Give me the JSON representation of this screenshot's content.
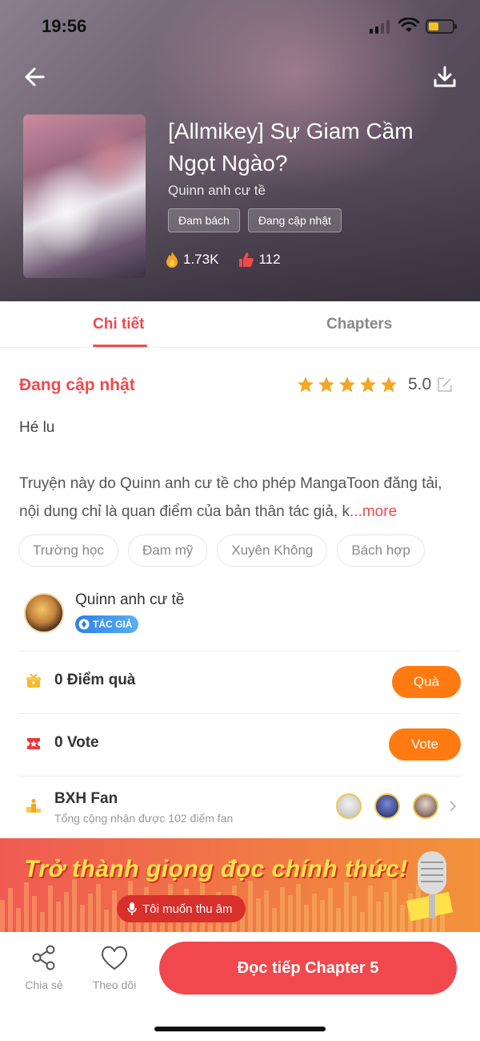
{
  "status_bar": {
    "time": "19:56"
  },
  "header": {
    "title": "[Allmikey] Sự Giam Cầm Ngọt Ngào?",
    "author": "Quinn anh cư tề",
    "genre_tags": [
      "Đam bách",
      "Đang cập nhật"
    ],
    "stats": {
      "views": "1.73K",
      "likes": "112"
    },
    "icons": {
      "back": "back-arrow-icon",
      "download": "download-icon",
      "views": "fire-icon",
      "likes": "thumb-up-icon"
    }
  },
  "tabs": [
    {
      "label": "Chi tiết",
      "active": true
    },
    {
      "label": "Chapters",
      "active": false
    }
  ],
  "details": {
    "status": "Đang cập nhật",
    "rating": {
      "stars": 5,
      "value": "5.0"
    },
    "subtitle": "Hé lu",
    "description": "Truyện này do Quinn anh cư tề cho phép MangaToon đăng tải, nội dung chỉ là quan điểm của bản thân tác giả, k",
    "more_label": "...more",
    "tags": [
      "Trường học",
      "Đam mỹ",
      "Xuyên Không",
      "Bách hợp"
    ]
  },
  "author_card": {
    "name": "Quinn anh cư tề",
    "badge": "TÁC GIẢ"
  },
  "gift_row": {
    "label": "0 Điểm quà",
    "button": "Quà"
  },
  "vote_row": {
    "label": "0 Vote",
    "button": "Vote"
  },
  "fan_row": {
    "title": "BXH Fan",
    "subtitle": "Tổng cộng nhận được 102 điểm fan"
  },
  "banner": {
    "title": "Trở thành giọng đọc chính thức!",
    "button": "Tôi muốn thu âm"
  },
  "bottom_bar": {
    "share_label": "Chia sẻ",
    "follow_label": "Theo dõi",
    "read_button": "Đọc tiếp Chapter 5"
  },
  "colors": {
    "accent": "#f0484d",
    "orange": "#ff7a10",
    "star": "#f5a623"
  }
}
